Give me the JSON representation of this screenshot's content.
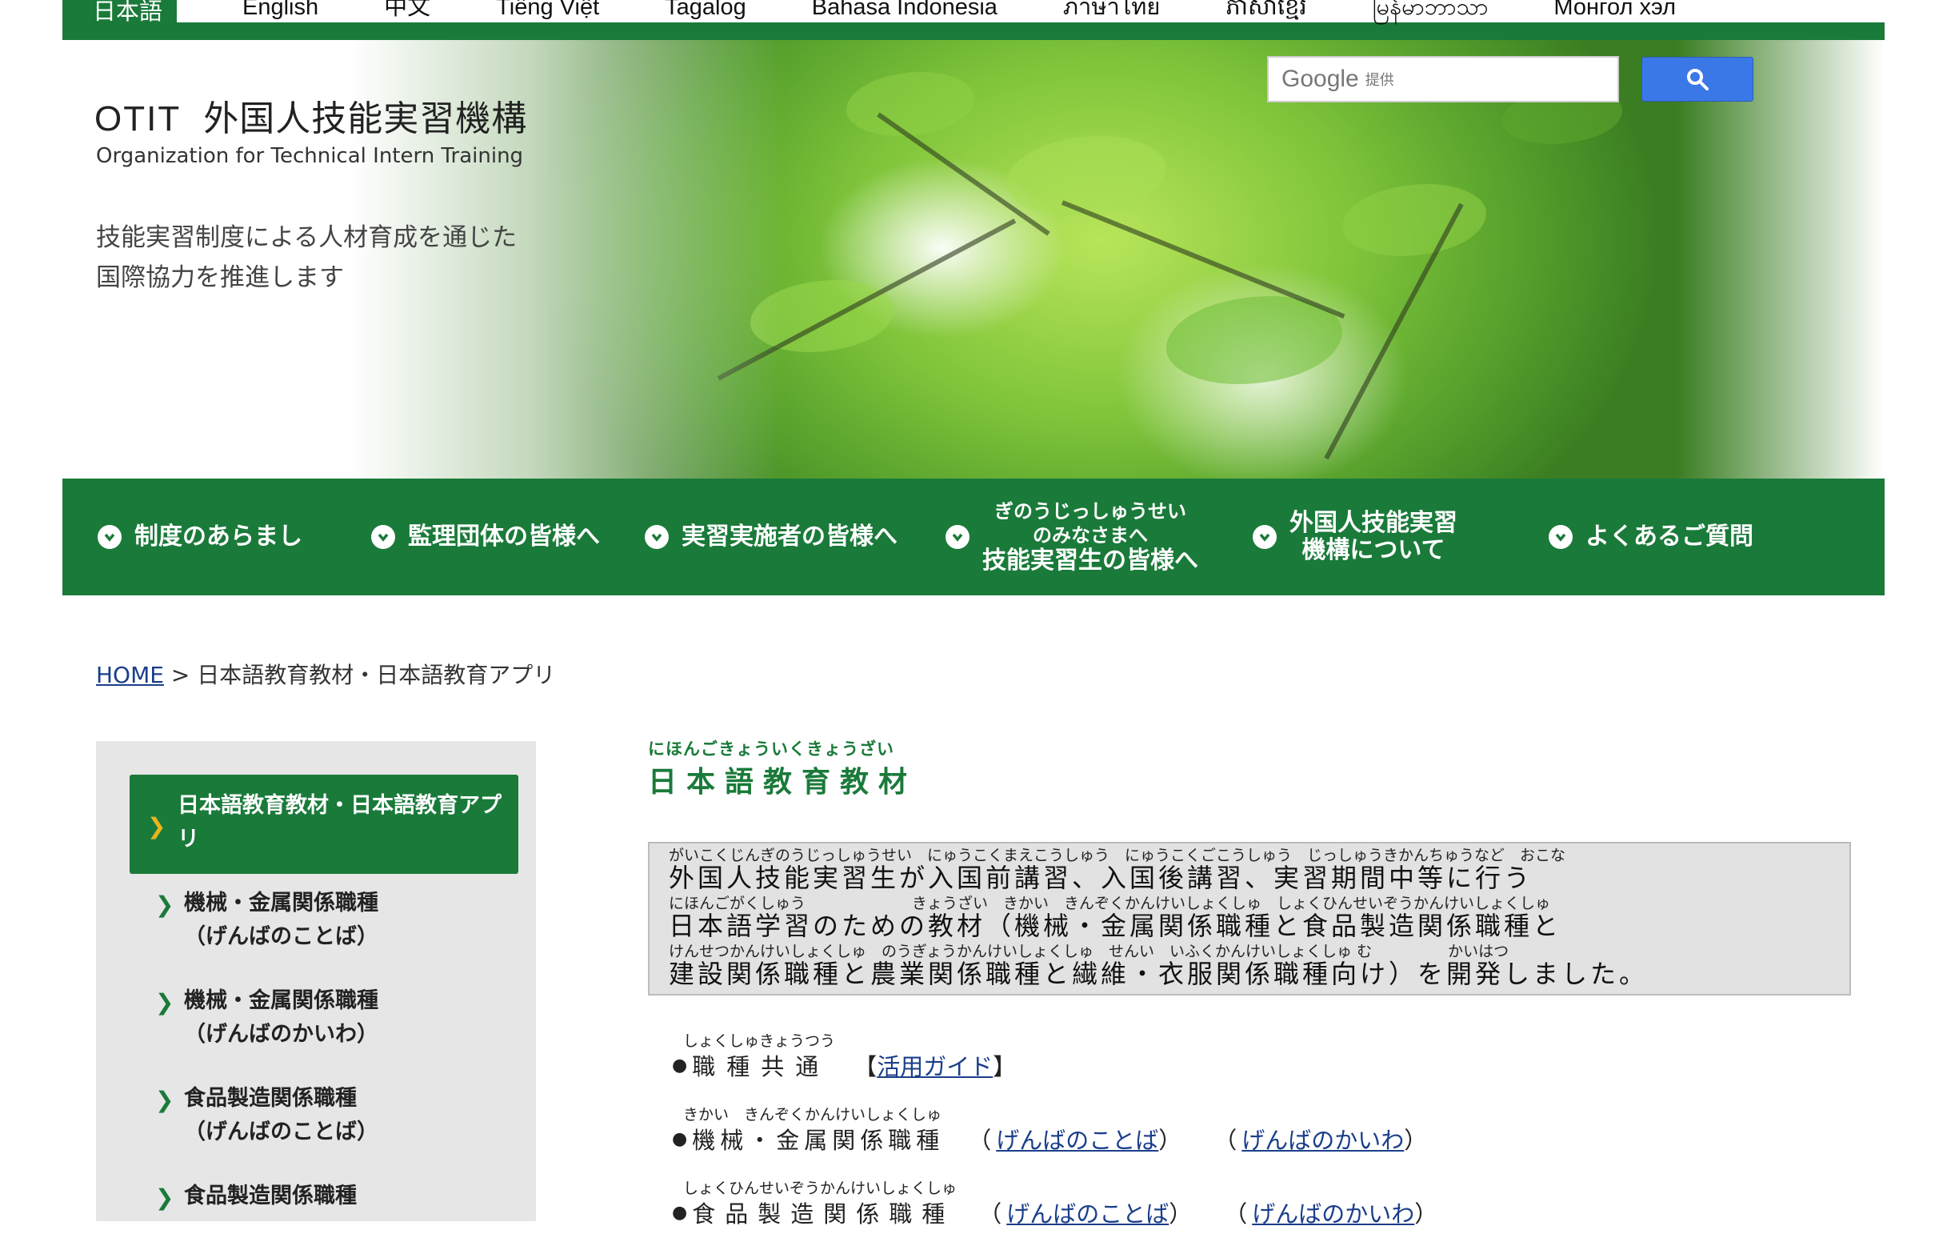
{
  "languages": [
    {
      "label": "日本語",
      "active": true
    },
    {
      "label": "English"
    },
    {
      "label": "中文"
    },
    {
      "label": "Tiếng Việt"
    },
    {
      "label": "Tagalog"
    },
    {
      "label": "Bahasa Indonesia"
    },
    {
      "label": "ภาษาไทย"
    },
    {
      "label": "ភាសាខ្មែរ"
    },
    {
      "label": "မြန်မာဘာသာ"
    },
    {
      "label": "Монгол хэл"
    }
  ],
  "header": {
    "logo_abbr": "OTIT",
    "logo_name": "外国人技能実習機構",
    "logo_sub": "Organization for Technical Intern Training",
    "tagline_1": "技能実習制度による人材育成を通じた",
    "tagline_2": "国際協力を推進します"
  },
  "search": {
    "brand": "Google",
    "provided": "提供"
  },
  "nav": [
    {
      "label": "制度のあらまし"
    },
    {
      "label": "監理団体の皆様へ"
    },
    {
      "label": "実習実施者の皆様へ"
    },
    {
      "ruby_1": "ぎのうじっしゅうせい",
      "ruby_2": "のみなさまへ",
      "label": "技能実習生の皆様へ"
    },
    {
      "label_1": "外国人技能実習",
      "label_2": "機構について"
    },
    {
      "label": "よくあるご質問"
    }
  ],
  "breadcrumb": {
    "home": "HOME",
    "sep": ">",
    "current": "日本語教育教材・日本語教育アプリ"
  },
  "sidebar": {
    "active_1": "日本語教育教材・日本語教育アプ",
    "active_2": "リ",
    "items": [
      {
        "line1": "機械・金属関係職種",
        "line2": "（げんばのことば）"
      },
      {
        "line1": "機械・金属関係職種",
        "line2": "（げんばのかいわ）"
      },
      {
        "line1": "食品製造関係職種",
        "line2": "（げんばのことば）"
      },
      {
        "line1": "食品製造関係職種",
        "line2": ""
      }
    ]
  },
  "main": {
    "title_ruby": "にほんごきょういくきょうざい",
    "title": "日本語教育教材",
    "intro": [
      {
        "ruby": "がいこくじんぎのうじっしゅうせい　にゅうこくまえこうしゅう　にゅうこくごこうしゅう　じっしゅうきかんちゅうなど　おこな",
        "text": "外国人技能実習生が入国前講習、入国後講習、実習期間中等に行う"
      },
      {
        "ruby": "にほんごがくしゅう　　　　　　　きょうざい　きかい　きんぞくかんけいしょくしゅ　しょくひんせいぞうかんけいしょくしゅ",
        "text": "日本語学習のための教材（機械・金属関係職種と食品製造関係職種と"
      },
      {
        "ruby": "けんせつかんけいしょくしゅ　のうぎょうかんけいしょくしゅ　せんい　いふくかんけいしょくしゅ む　　　　　かいはつ",
        "text": "建設関係職種と農業関係職種と繊維・衣服関係職種向け）を開発しました。"
      }
    ],
    "list": [
      {
        "ruby": "しょくしゅきょうつう",
        "term": "職種共通",
        "link_a": "活用ガイド",
        "link_b": ""
      },
      {
        "ruby": "きかい　きんぞくかんけいしょくしゅ",
        "term": "機械・金属関係職種",
        "link_a": "げんばのことば",
        "link_b": "げんばのかいわ"
      },
      {
        "ruby": "しょくひんせいぞうかんけいしょくしゅ",
        "term": "食品製造関係職種",
        "link_a": "げんばのことば",
        "link_b": "げんばのかいわ"
      }
    ]
  },
  "colors": {
    "brand_green": "#1a7a3a",
    "link_blue": "#1a3e8a",
    "search_blue": "#3b78e7",
    "chevron_gold": "#e8b520"
  },
  "icons": {
    "nav_chevron": "chevron-down-circle-icon",
    "side_arrow": "chevron-right-icon",
    "search": "search-icon"
  }
}
